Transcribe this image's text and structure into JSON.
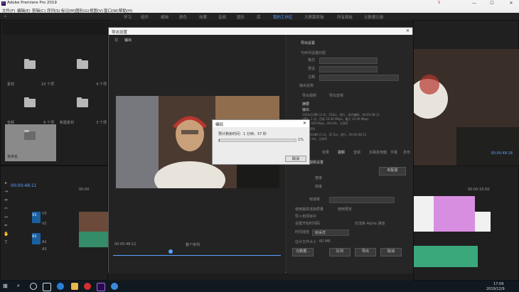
{
  "window": {
    "app_title": "Adobe Premiere Pro 2019",
    "icon": "Pr",
    "min": "—",
    "max": "☐",
    "close": "✕",
    "ime_badge": "S"
  },
  "menu": {
    "items": [
      "文件(F)",
      "编辑(E)",
      "剪辑(C)",
      "序列(S)",
      "标记(M)",
      "图形(G)",
      "视图(V)",
      "窗口(W)",
      "帮助(H)"
    ]
  },
  "workspaces": {
    "items": [
      "学习",
      "组件",
      "编辑",
      "颜色",
      "效果",
      "音频",
      "图形",
      "库",
      "我的工作区",
      "大屏幕剪辑",
      "所有面板",
      "元数据记录"
    ]
  },
  "project": {
    "bins": [
      {
        "label": "素材",
        "count": "10 个项"
      },
      {
        "label": "",
        "count": "4 个项"
      },
      {
        "label": "音频",
        "count": "6 个项"
      },
      {
        "label": "新建素材",
        "count": "3 个项"
      },
      {
        "label": "未命名",
        "count": ""
      }
    ]
  },
  "timeline": {
    "timecode": "00:00:48:11",
    "ruler1": "00:00",
    "ruler2": "00:00:15:00",
    "tracks": [
      "V3",
      "V2",
      "V1",
      "A1",
      "A2",
      "A3"
    ]
  },
  "program": {
    "timecode": "00:00:48:18"
  },
  "export_dialog": {
    "title": "导出设置",
    "source_tab": "源",
    "output_tab": "输出",
    "export_settings_header": "导出设置",
    "match_sequence": "与序列设置匹配",
    "format_label": "格式",
    "preset_label": "预设",
    "comments_label": "注释",
    "output_name_label": "输出名称",
    "export_video": "导出视频",
    "export_audio": "导出音频",
    "summary_header": "摘要",
    "output_label": "输出",
    "output_line1": "1920x1080 (1.0)，25fps，逐行，软件编码，00:00:48:11",
    "output_line2": "VBR，1 次，目标 10.00 Mbps，最大 12.00 Mbps",
    "output_line3": "AAC，320 Kbps，48 kHz，立体声",
    "source_label": "源",
    "source_line1": "序列",
    "source_line2": "1920x1080 (1.0)，25 fps，逐行，00:00:48:11",
    "source_line3": "48000 Hz，立体声",
    "tabs": [
      "效果",
      "视频",
      "音频",
      "多路复用器",
      "字幕",
      "发布"
    ],
    "basic_video_header": "基本视频设置",
    "width_label": "宽度",
    "height_label": "高度",
    "framerate_label": "帧速率",
    "match_source_btn": "匹配源",
    "max_render": "使用最高渲染质量",
    "use_previews": "使用预览",
    "import_project": "导入到项目中",
    "set_start_tc": "设置开始时间码",
    "render_alpha": "仅渲染 Alpha 通道",
    "time_interp_label": "时间插值",
    "time_interp_value": "帧采样",
    "estimated_size_label": "估计文件大小",
    "estimated_size_value": "60 MB",
    "metadata_btn": "元数据...",
    "queue_btn": "队列",
    "export_btn": "导出",
    "cancel_btn": "取消",
    "src_timecode": "00:00:48:11",
    "source_range": "整个序列"
  },
  "progress_modal": {
    "title": "编码",
    "status": "预计剩余时间：1 分钟，37 秒",
    "percent": "1%",
    "progress": 0.01,
    "cancel": "取消"
  },
  "taskbar": {
    "time": "17:09",
    "date": "2019/12/9"
  },
  "colors": {
    "accent": "#5aa0ff",
    "clip_pink": "#d88ee0",
    "audio_green": "#3aa87a",
    "video_blue": "#1a5fa0"
  }
}
